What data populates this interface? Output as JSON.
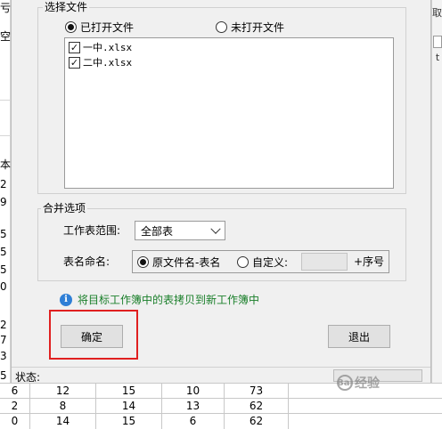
{
  "background": {
    "left_glyphs": [
      "亏",
      "空",
      "",
      "",
      "本",
      "2",
      "9",
      "",
      "5",
      "5",
      "5",
      "5",
      "0",
      "",
      "2",
      "7",
      "3",
      "",
      "5"
    ],
    "right_labels": [
      "取",
      "",
      "t"
    ],
    "table_rows": [
      [
        "6",
        "12",
        "15",
        "10",
        "73"
      ],
      [
        "2",
        "8",
        "14",
        "13",
        "62"
      ],
      [
        "0",
        "14",
        "15",
        "6",
        "62"
      ]
    ]
  },
  "dialog": {
    "file_group": {
      "title": "选择文件",
      "radio_opened": "已打开文件",
      "radio_unopened": "未打开文件",
      "files": [
        "一中.xlsx",
        "二中.xlsx"
      ]
    },
    "merge_group": {
      "title": "合并选项",
      "sheet_range_label": "工作表范围:",
      "sheet_range_value": "全部表",
      "naming_label": "表名命名:",
      "naming_option_original": "原文件名-表名",
      "naming_option_custom": "自定义:",
      "custom_input_value": "",
      "suffix_label": "+序号"
    },
    "info_icon_glyph": "i",
    "info_text": "将目标工作簿中的表拷贝到新工作簿中",
    "ok_button": "确定",
    "exit_button": "退出",
    "status_label": "状态:"
  },
  "watermark": {
    "logo_glyph": "Bai",
    "text": "经验"
  },
  "colors": {
    "highlight": "#e02020",
    "info_text": "#1a7f2a",
    "info_icon": "#2f7fd6"
  }
}
